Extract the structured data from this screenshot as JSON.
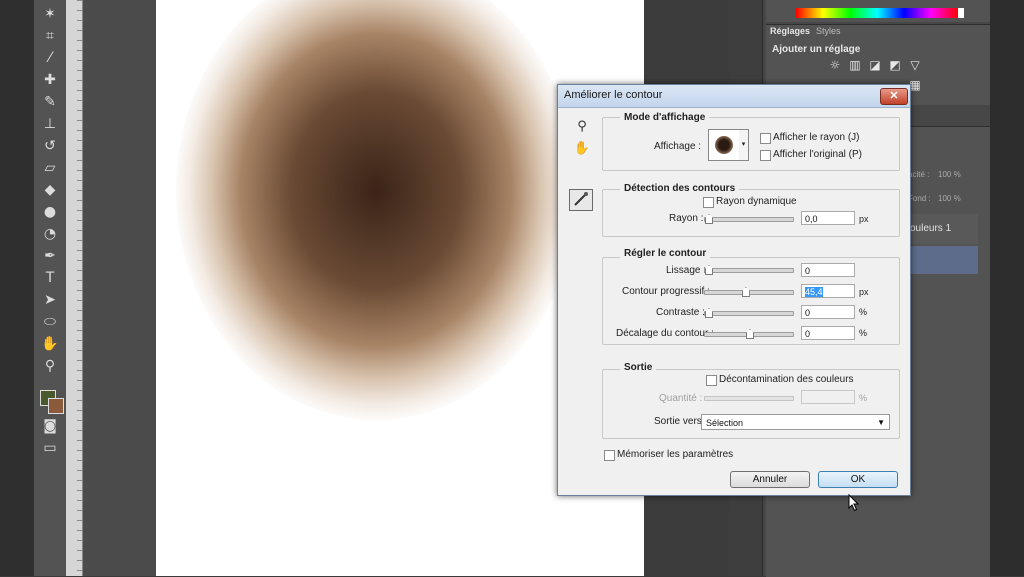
{
  "toolbar": {
    "tools": [
      "magic-wand",
      "crop",
      "eyedropper",
      "spot-healing",
      "brush",
      "clone-stamp",
      "history-brush",
      "eraser",
      "paint-bucket",
      "blur",
      "dodge",
      "pen",
      "type",
      "path-selection",
      "ellipse",
      "hand",
      "zoom"
    ]
  },
  "panels": {
    "tab_adjustments": "Réglages",
    "tab_styles": "Styles",
    "adjust_title": "Ajouter un réglage",
    "opacity_label": "acité :",
    "opacity_value": "100 %",
    "fill_label": "Fond :",
    "fill_value": "100 %",
    "layer_name": "ouleurs 1"
  },
  "dialog": {
    "title": "Améliorer le contour",
    "close_glyph": "✕",
    "view_mode": {
      "group_title": "Mode d'affichage",
      "view_label": "Affichage :",
      "show_radius": "Afficher le rayon (J)",
      "show_original": "Afficher l'original (P)"
    },
    "edge_detection": {
      "group_title": "Détection des contours",
      "smart_radius": "Rayon dynamique",
      "radius_label": "Rayon :",
      "radius_value": "0,0",
      "radius_unit": "px",
      "radius_fraction": 0
    },
    "adjust_edge": {
      "group_title": "Régler le contour",
      "smooth_label": "Lissage :",
      "smooth_value": "0",
      "smooth_fraction": 0,
      "feather_label": "Contour progressif :",
      "feather_value": "45,4",
      "feather_unit": "px",
      "feather_fraction": 0.45,
      "contrast_label": "Contraste :",
      "contrast_value": "0",
      "contrast_unit": "%",
      "contrast_fraction": 0,
      "shift_label": "Décalage du contour :",
      "shift_value": "0",
      "shift_unit": "%",
      "shift_fraction": 0.5
    },
    "output": {
      "group_title": "Sortie",
      "decontaminate": "Décontamination des couleurs",
      "amount_label": "Quantité :",
      "amount_unit": "%",
      "output_to_label": "Sortie vers :",
      "output_to_value": "Sélection"
    },
    "remember_settings": "Mémoriser les paramètres",
    "cancel_label": "Annuler",
    "ok_label": "OK"
  }
}
